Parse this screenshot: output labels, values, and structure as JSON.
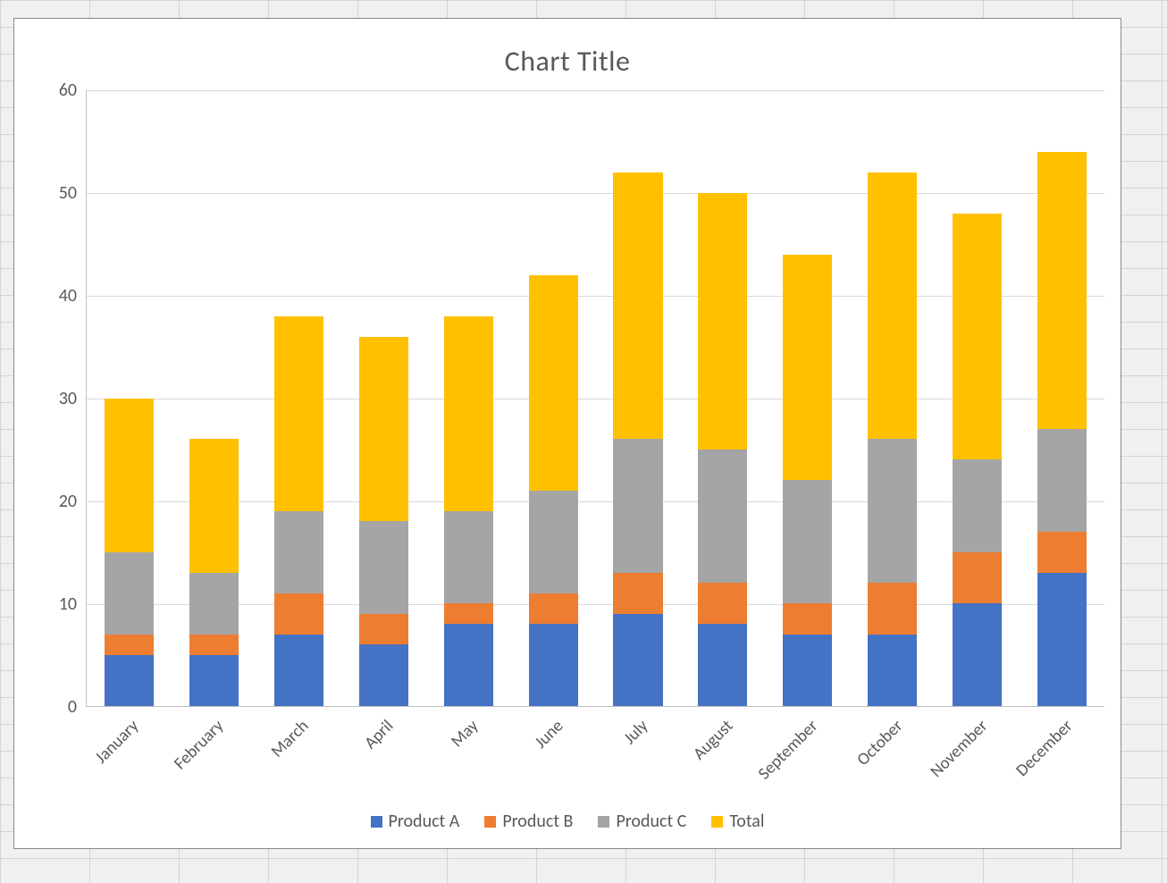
{
  "chart_data": {
    "type": "bar",
    "stacked": true,
    "title": "Chart Title",
    "xlabel": "",
    "ylabel": "",
    "ylim": [
      0,
      60
    ],
    "ytick_step": 10,
    "categories": [
      "January",
      "February",
      "March",
      "April",
      "May",
      "June",
      "July",
      "August",
      "September",
      "October",
      "November",
      "December"
    ],
    "series": [
      {
        "name": "Product A",
        "color": "#4472C4",
        "values": [
          5,
          5,
          7,
          6,
          8,
          8,
          9,
          8,
          7,
          7,
          10,
          13
        ]
      },
      {
        "name": "Product B",
        "color": "#ED7D31",
        "values": [
          2,
          2,
          4,
          3,
          2,
          3,
          4,
          4,
          3,
          5,
          5,
          4
        ]
      },
      {
        "name": "Product C",
        "color": "#A5A5A5",
        "values": [
          8,
          6,
          8,
          9,
          9,
          10,
          13,
          13,
          12,
          14,
          9,
          10
        ]
      },
      {
        "name": "Total",
        "color": "#FFC000",
        "values": [
          15,
          13,
          19,
          18,
          19,
          21,
          26,
          25,
          22,
          26,
          24,
          27
        ]
      }
    ],
    "legend_position": "bottom",
    "grid": true
  }
}
